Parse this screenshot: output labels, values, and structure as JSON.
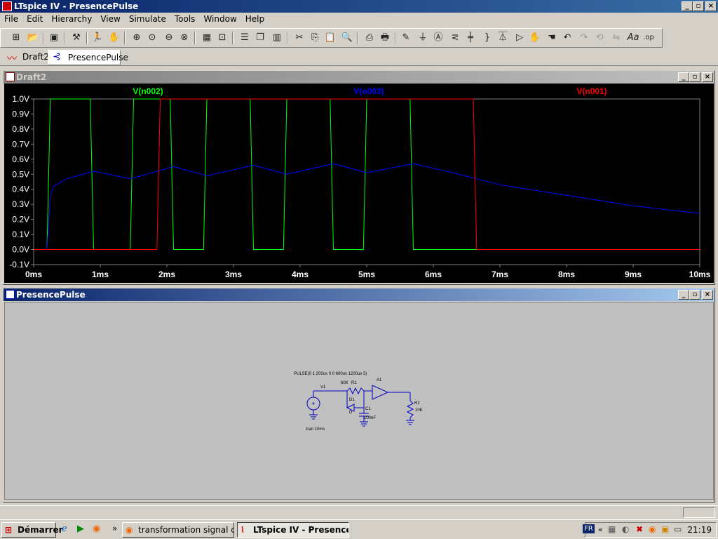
{
  "window": {
    "title": "LTspice IV - PresencePulse"
  },
  "menu": [
    "File",
    "Edit",
    "Hierarchy",
    "View",
    "Simulate",
    "Tools",
    "Window",
    "Help"
  ],
  "toolbar": {
    "icons": [
      "new-schematic-icon",
      "open-icon",
      "save-icon",
      "control-panel-icon",
      "run-icon",
      "halt-icon",
      "zoom-in-icon",
      "zoom-pan-icon",
      "zoom-out-icon",
      "zoom-cancel-icon",
      "autorange-icon",
      "zoom-extents-icon",
      "tile-horizontal-icon",
      "cascade-icon",
      "tile-vertical-icon",
      "cut-icon",
      "copy-icon",
      "paste-icon",
      "find-icon",
      "print-setup-icon",
      "print-icon",
      "wire-icon",
      "ground-icon",
      "label-net-icon",
      "resistor-icon",
      "capacitor-icon",
      "inductor-icon",
      "diode-icon",
      "component-icon",
      "move-icon",
      "drag-icon",
      "undo-icon",
      "redo-icon",
      "rotate-icon",
      "mirror-icon",
      "text-icon",
      "spice-directive-icon"
    ]
  },
  "tabs": [
    {
      "label": "Draft2",
      "active": false
    },
    {
      "label": "PresencePulse",
      "active": true
    }
  ],
  "plot_window": {
    "title": "Draft2"
  },
  "schematic_window": {
    "title": "PresencePulse"
  },
  "chart_data": {
    "type": "line",
    "xlabel": "",
    "ylabel": "",
    "xlim": [
      0,
      10
    ],
    "ylim": [
      -0.1,
      1.0
    ],
    "x_ticks": [
      "0ms",
      "1ms",
      "2ms",
      "3ms",
      "4ms",
      "5ms",
      "6ms",
      "7ms",
      "8ms",
      "9ms",
      "10ms"
    ],
    "y_ticks": [
      "1.0V",
      "0.9V",
      "0.8V",
      "0.7V",
      "0.6V",
      "0.5V",
      "0.4V",
      "0.3V",
      "0.2V",
      "0.1V",
      "0.0V",
      "-0.1V"
    ],
    "grid": false,
    "series": [
      {
        "name": "V(n002)",
        "color": "#00ff00",
        "x": [
          0,
          0.2,
          0.25,
          0.85,
          0.9,
          1.45,
          1.5,
          2.05,
          2.1,
          2.55,
          2.6,
          3.25,
          3.3,
          3.75,
          3.8,
          4.45,
          4.5,
          4.95,
          5.0,
          5.65,
          5.7,
          6.15,
          6.2,
          10
        ],
        "y": [
          0,
          0,
          1,
          1,
          0,
          0,
          1,
          1,
          0,
          0,
          1,
          1,
          0,
          0,
          1,
          1,
          0,
          0,
          1,
          1,
          0,
          0,
          0,
          0
        ]
      },
      {
        "name": "V(n003)",
        "color": "#0000ff",
        "x": [
          0,
          0.2,
          0.25,
          0.3,
          0.5,
          0.9,
          1.45,
          2.1,
          2.6,
          3.3,
          3.8,
          4.5,
          5.0,
          5.7,
          6.2,
          6.65,
          7,
          8,
          9,
          10
        ],
        "y": [
          0,
          0,
          0.35,
          0.42,
          0.47,
          0.52,
          0.47,
          0.55,
          0.49,
          0.56,
          0.5,
          0.57,
          0.51,
          0.57,
          0.52,
          0.47,
          0.43,
          0.36,
          0.29,
          0.24
        ]
      },
      {
        "name": "V(n001)",
        "color": "#ff0000",
        "x": [
          0,
          1.85,
          1.9,
          6.6,
          6.65,
          10
        ],
        "y": [
          0,
          0,
          1,
          1,
          0,
          0
        ]
      }
    ]
  },
  "schematic": {
    "source_directive": "PULSE(0 1 200us 0 0 600us 1200us 5)",
    "tran_directive": ".tran 10ms",
    "v1_label": "V1",
    "r1_label": "R1",
    "r1_value": "60K",
    "d1_label": "D1",
    "d1_model": "D",
    "c1_label": "C1",
    "c1_value": "100nF",
    "a1_label": "A1",
    "r2_label": "R2",
    "r2_value": "10K"
  },
  "taskbar": {
    "start_label": "Démarrer",
    "buttons": [
      {
        "label": "transformation signal car...",
        "active": false
      },
      {
        "label": "LTspice IV - Presence...",
        "active": true
      }
    ],
    "lang": "FR",
    "clock": "21:19"
  }
}
